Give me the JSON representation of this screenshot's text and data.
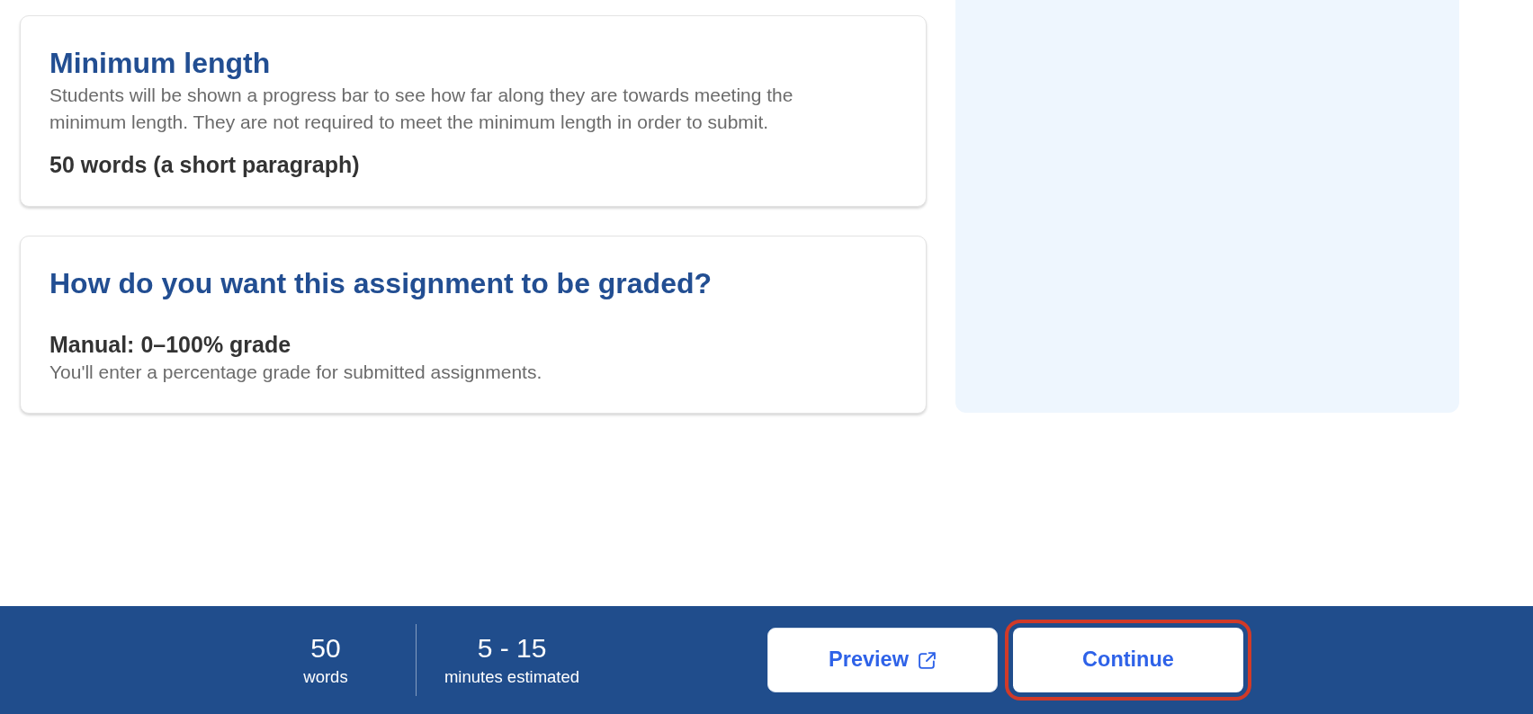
{
  "cards": [
    {
      "title": "Minimum length",
      "description": "Students will be shown a progress bar to see how far along they are towards meeting the minimum length. They are not required to meet the minimum length in order to submit.",
      "value": "50 words (a short paragraph)"
    },
    {
      "title": "How do you want this assignment to be graded?",
      "option": {
        "label": "Manual: 0–100% grade",
        "description": "You'll enter a percentage grade for submitted assignments."
      }
    }
  ],
  "footer": {
    "stats": [
      {
        "value": "50",
        "label": "words"
      },
      {
        "value": "5 - 15",
        "label": "minutes estimated"
      }
    ],
    "buttons": [
      {
        "label": "Preview",
        "kind": "external",
        "focused": false
      },
      {
        "label": "Continue",
        "kind": "plain",
        "focused": true
      }
    ]
  }
}
